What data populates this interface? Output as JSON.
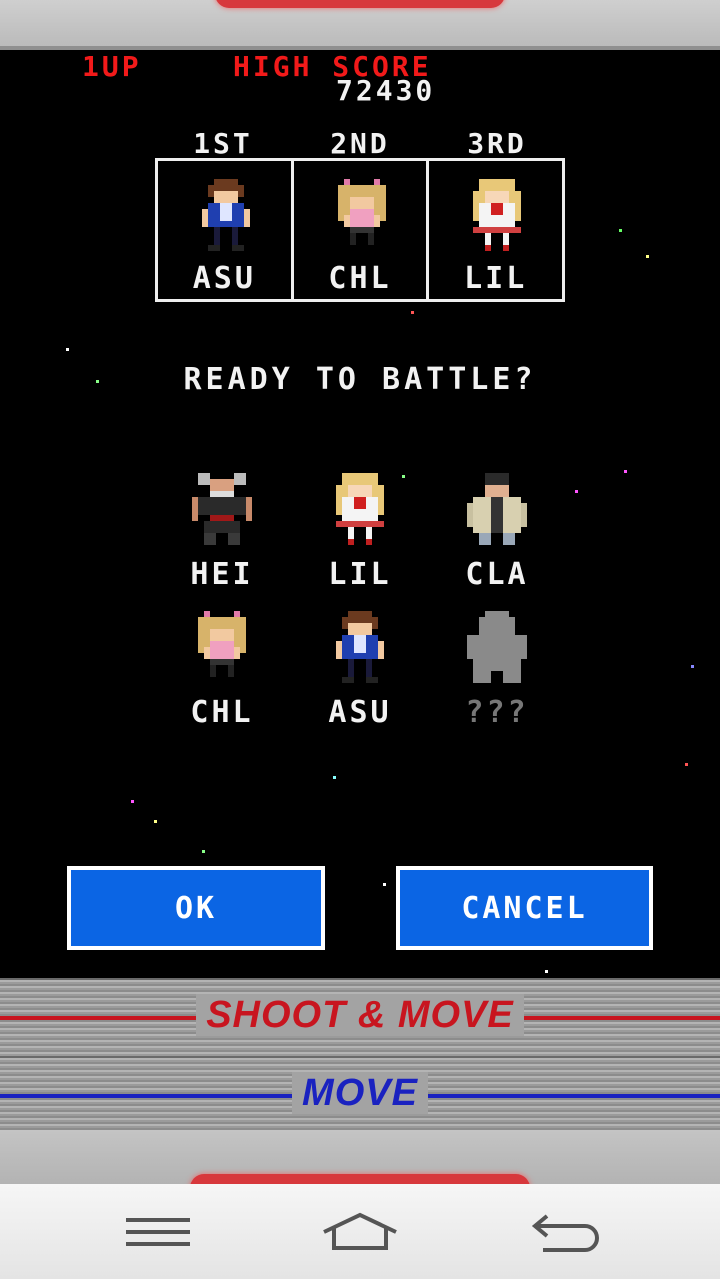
{
  "hud": {
    "player_label": "1UP",
    "high_score_label": "HIGH SCORE",
    "high_score": "72430"
  },
  "ranking": {
    "headers": [
      "1ST",
      "2ND",
      "3RD"
    ],
    "entries": [
      {
        "name": "ASU",
        "sprite": "asu"
      },
      {
        "name": "CHL",
        "sprite": "chl"
      },
      {
        "name": "LIL",
        "sprite": "lil"
      }
    ]
  },
  "prompt": "READY TO BATTLE?",
  "characters": [
    {
      "name": "HEI",
      "sprite": "hei",
      "locked": false
    },
    {
      "name": "LIL",
      "sprite": "lil",
      "locked": false
    },
    {
      "name": "CLA",
      "sprite": "cla",
      "locked": false
    },
    {
      "name": "CHL",
      "sprite": "chl",
      "locked": false
    },
    {
      "name": "ASU",
      "sprite": "asu",
      "locked": false
    },
    {
      "name": "???",
      "sprite": "locked-silhouette",
      "locked": true
    }
  ],
  "buttons": {
    "ok": "OK",
    "cancel": "CANCEL"
  },
  "controls": {
    "shoot_move": "SHOOT & MOVE",
    "move": "MOVE"
  },
  "navbar": {
    "menu_icon": "menu-icon",
    "home_icon": "home-icon",
    "back_icon": "back-icon"
  },
  "colors": {
    "accent_red": "#f21a1a",
    "button_blue": "#0b65e4",
    "shoot_label": "#c8151f",
    "move_label": "#1a22c0"
  }
}
